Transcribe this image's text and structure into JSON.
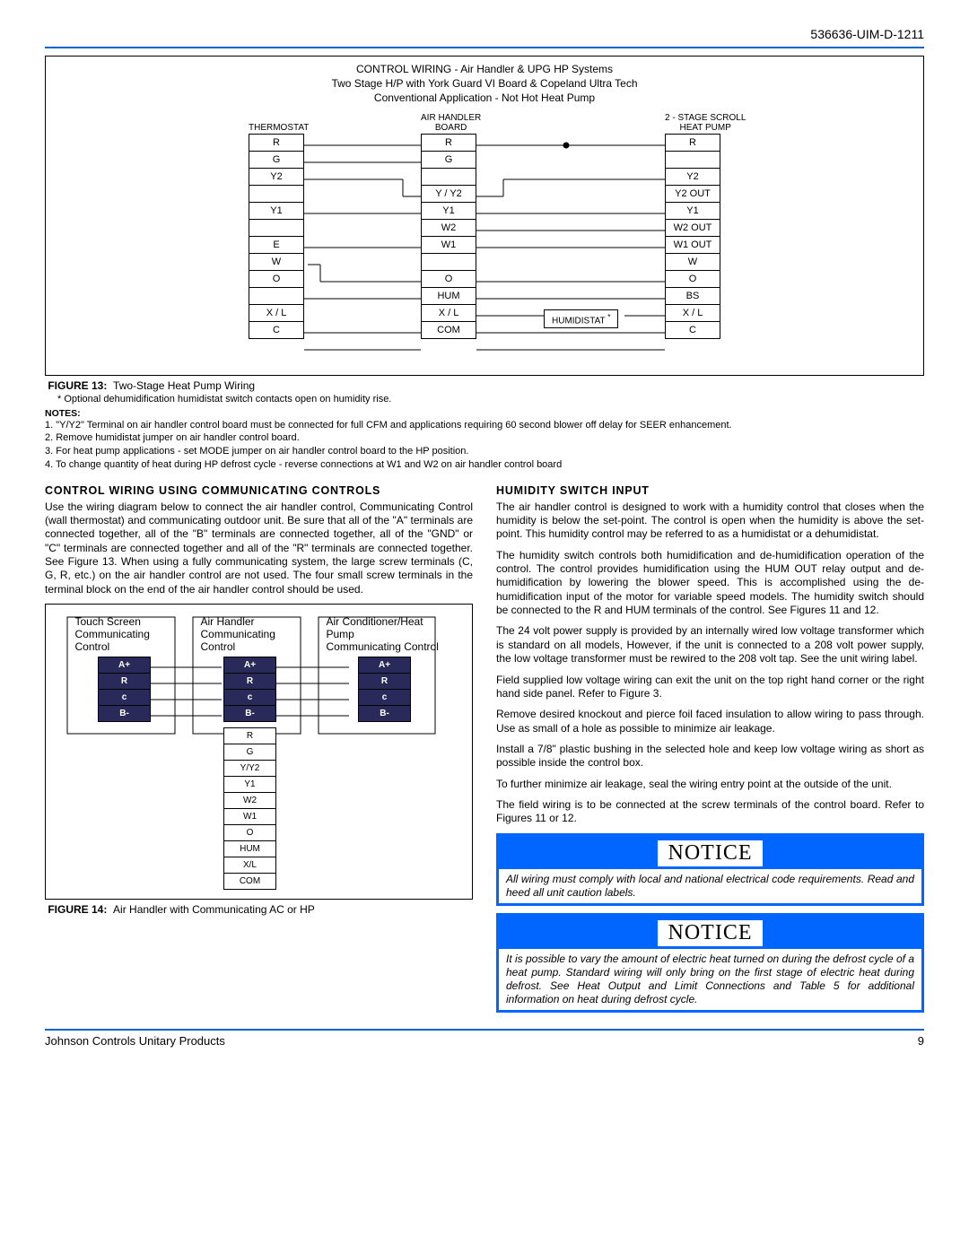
{
  "doc_id": "536636-UIM-D-1211",
  "figure13": {
    "title_l1": "CONTROL WIRING - Air Handler & UPG HP Systems",
    "title_l2": "Two Stage H/P with York Guard VI Board & Copeland  Ultra Tech",
    "title_l3": "Conventional Application - Not Hot Heat Pump",
    "col_thermo": "THERMOSTAT",
    "col_board": "AIR HANDLER\nBOARD",
    "col_hp": "2 - STAGE SCROLL\nHEAT PUMP",
    "thermo": [
      "R",
      "G",
      "Y2",
      "",
      "Y1",
      "",
      "E",
      "W",
      "O",
      "",
      "X / L",
      "C"
    ],
    "board": [
      "R",
      "G",
      "",
      "Y / Y2",
      "Y1",
      "W2",
      "W1",
      "",
      "O",
      "HUM",
      "X / L",
      "COM"
    ],
    "heatpump": [
      "R",
      "",
      "Y2",
      "Y2 OUT",
      "Y1",
      "W2 OUT",
      "W1 OUT",
      "W",
      "O",
      "BS",
      "X / L",
      "C"
    ],
    "humidistat": "HUMIDISTAT",
    "caption_label": "FIGURE 13:",
    "caption_text": "Two-Stage Heat Pump Wiring",
    "star_note": "Optional dehumidification humidistat switch contacts open on humidity rise.",
    "notes_hdr": "NOTES:",
    "notes": [
      "1. \"Y/Y2\" Terminal on air handler control board must be connected for full CFM and applications requiring 60 second blower off delay for SEER enhancement.",
      "2. Remove humidistat jumper on air handler control board.",
      "3. For heat pump applications - set MODE jumper on air handler control board to the HP position.",
      "4. To change quantity of heat during HP defrost cycle - reverse connections at W1 and W2 on air handler control board"
    ]
  },
  "left_section": {
    "heading": "CONTROL WIRING USING COMMUNICATING CONTROLS",
    "para1": "Use the wiring diagram below to connect the air handler control, Communicating Control (wall thermostat) and communicating outdoor unit. Be sure that all of the \"A\" terminals are connected together, all of the \"B\" terminals are connected together, all of the \"GND\" or \"C\" terminals are connected together and all of the \"R\" terminals are connected together. See Figure 13. When using a fully communicating system, the large screw terminals (C, G, R, etc.) on the air handler control are not used. The four small screw terminals in the terminal block on the end of the air handler control should be used."
  },
  "figure14": {
    "col1": "Touch Screen\nCommunicating\nControl",
    "col2": "Air Handler\nCommunicating\nControl",
    "col3": "Air Conditioner/Heat Pump\nCommunicating Control",
    "terminals": [
      "A+",
      "R",
      "c",
      "B-"
    ],
    "extra": [
      "R",
      "G",
      "Y/Y2",
      "Y1",
      "W2",
      "W1",
      "O",
      "HUM",
      "X/L",
      "COM"
    ],
    "caption_label": "FIGURE 14:",
    "caption_text": "Air Handler with Communicating AC or HP"
  },
  "right_section": {
    "heading": "HUMIDITY SWITCH INPUT",
    "paras": [
      "The air handler control is designed to work with a humidity control that closes when the humidity is below the set-point. The control is open when the humidity is above the set-point. This humidity control may be referred to as a humidistat or a dehumidistat.",
      "The humidity switch controls both humidification and de-humidification operation of the control. The control provides humidification using the HUM OUT relay output and de-humidification by lowering the blower speed. This is accomplished using the de-humidification input of the motor for variable speed models. The humidity switch should be connected to the R and HUM terminals of the control. See Figures 11 and 12.",
      "The 24 volt power supply is provided by an internally wired low voltage transformer which is standard on all models, However, if the unit is connected to a 208 volt power supply, the low voltage transformer must be rewired to the 208 volt tap. See the unit wiring label.",
      "Field supplied low voltage wiring can exit the unit on the top right hand corner or the right hand side panel. Refer to Figure 3.",
      "Remove desired knockout and pierce foil faced insulation to allow wiring to pass through. Use as small of a hole as possible to minimize air leakage.",
      "Install a 7/8\" plastic bushing in the selected hole and keep low voltage wiring as short as possible inside the control box.",
      "To further minimize air leakage, seal the wiring entry point at the outside of the unit.",
      "The field wiring is to be connected at the screw terminals of the control board. Refer to Figures 11 or 12."
    ]
  },
  "notice1": {
    "label": "NOTICE",
    "body": "All wiring must comply with local and national electrical code requirements. Read and heed all unit caution labels."
  },
  "notice2": {
    "label": "NOTICE",
    "body": "It is possible to vary the amount of electric heat turned on during the defrost cycle of a heat pump. Standard wiring will only bring on the first stage of electric heat during defrost. See Heat Output and Limit Connections and Table 5 for additional information on heat during defrost cycle."
  },
  "footer": {
    "left": "Johnson Controls Unitary Products",
    "right": "9"
  }
}
